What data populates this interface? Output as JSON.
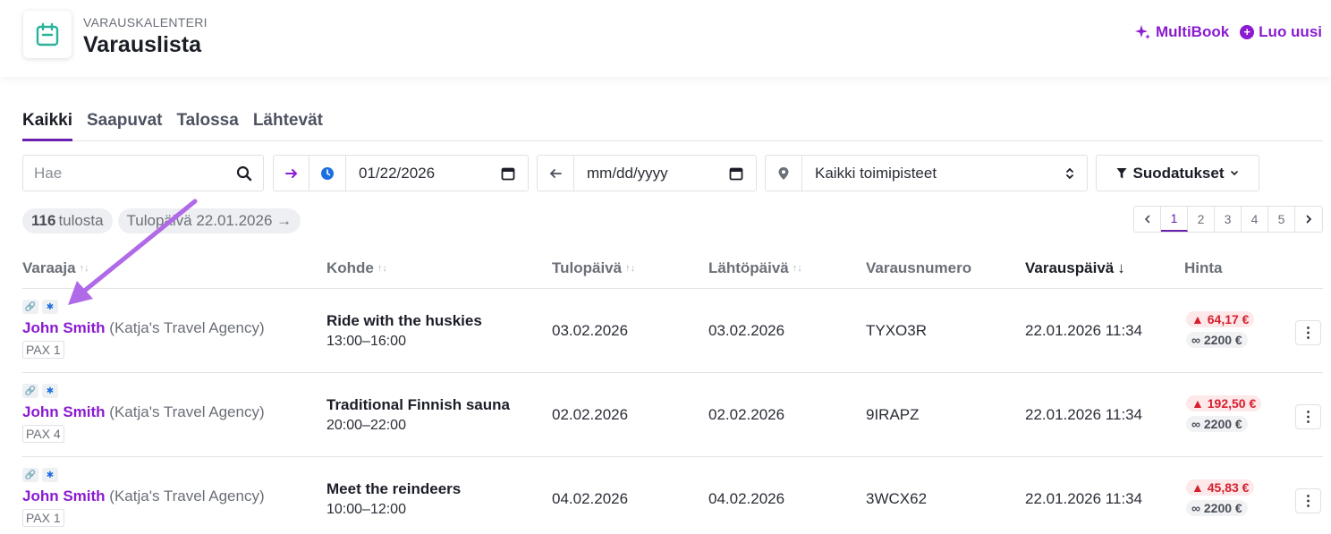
{
  "header": {
    "subtitle": "VARAUSKALENTERI",
    "title": "Varauslista",
    "multibook_label": "MultiBook",
    "new_label": "Luo uusi"
  },
  "tabs": [
    {
      "label": "Kaikki",
      "active": true
    },
    {
      "label": "Saapuvat"
    },
    {
      "label": "Talossa"
    },
    {
      "label": "Lähtevät"
    }
  ],
  "filters": {
    "search_placeholder": "Hae",
    "start_date": "01/22/2026",
    "end_date_placeholder": "mm/dd/yyyy",
    "location": "Kaikki toimipisteet",
    "filters_label": "Suodatukset"
  },
  "summary": {
    "count": "116",
    "count_label": "tulosta",
    "date_chip": "Tulopäivä 22.01.2026 →"
  },
  "pagination": {
    "pages": [
      "1",
      "2",
      "3",
      "4",
      "5"
    ],
    "active_page": "1"
  },
  "columns": [
    "Varaaja",
    "Kohde",
    "Tulopäivä",
    "Lähtöpäivä",
    "Varausnumero",
    "Varauspäivä",
    "Hinta"
  ],
  "rows": [
    {
      "name": "John Smith",
      "agency": "(Katja's Travel Agency)",
      "pax": "PAX 1",
      "target": "Ride with the huskies",
      "time": "13:00–16:00",
      "arrival": "03.02.2026",
      "departure": "03.02.2026",
      "booking_number": "TYXO3R",
      "booking_date": "22.01.2026 11:34",
      "price_due": "64,17 €",
      "price_link": "2200 €"
    },
    {
      "name": "John Smith",
      "agency": "(Katja's Travel Agency)",
      "pax": "PAX 4",
      "target": "Traditional Finnish sauna",
      "time": "20:00–22:00",
      "arrival": "02.02.2026",
      "departure": "02.02.2026",
      "booking_number": "9IRAPZ",
      "booking_date": "22.01.2026 11:34",
      "price_due": "192,50 €",
      "price_link": "2200 €"
    },
    {
      "name": "John Smith",
      "agency": "(Katja's Travel Agency)",
      "pax": "PAX 1",
      "target": "Meet the reindeers",
      "time": "10:00–12:00",
      "arrival": "04.02.2026",
      "departure": "04.02.2026",
      "booking_number": "3WCX62",
      "booking_date": "22.01.2026 11:34",
      "price_due": "45,83 €",
      "price_link": "2200 €"
    }
  ],
  "colors": {
    "accent": "#8a1bd0",
    "tab_underline": "#6b1fae",
    "annotation_arrow": "#b06ae8",
    "warning": "#d61f2c"
  }
}
